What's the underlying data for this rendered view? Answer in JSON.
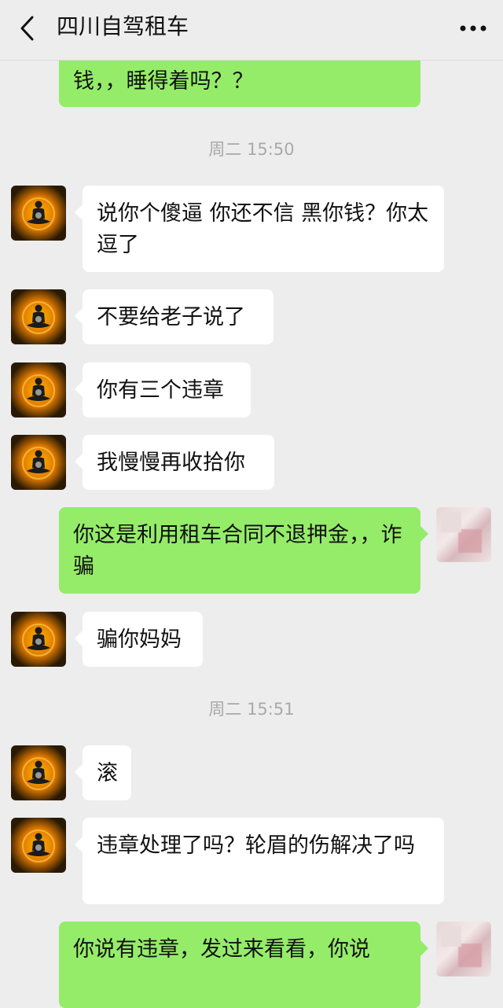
{
  "header": {
    "title": "四川自驾租车",
    "back_icon": "back-chevron-icon",
    "more_icon": "more-dots-icon"
  },
  "colors": {
    "background": "#ededed",
    "self_bubble": "#95ec69",
    "friend_bubble": "#ffffff",
    "timestamp_text": "#a9a9a9"
  },
  "messages": [
    {
      "side": "self",
      "text": "钱，，睡得着吗？？"
    },
    {
      "type": "time",
      "text": "周二 15:50"
    },
    {
      "side": "friend",
      "text": "说你个傻逼 你还不信 黑你钱？你太逗了"
    },
    {
      "side": "friend",
      "text": "不要给老子说了"
    },
    {
      "side": "friend",
      "text": "你有三个违章"
    },
    {
      "side": "friend",
      "text": "我慢慢再收拾你"
    },
    {
      "side": "self",
      "text": "你这是利用租车合同不退押金，，诈骗"
    },
    {
      "side": "friend",
      "text": "骗你妈妈"
    },
    {
      "type": "time",
      "text": "周二 15:51"
    },
    {
      "side": "friend",
      "text": "滚"
    },
    {
      "side": "friend",
      "text": "违章处理了吗？轮眉的伤解决了吗"
    },
    {
      "side": "self",
      "text": "你说有违章，发过来看看，你说"
    }
  ]
}
